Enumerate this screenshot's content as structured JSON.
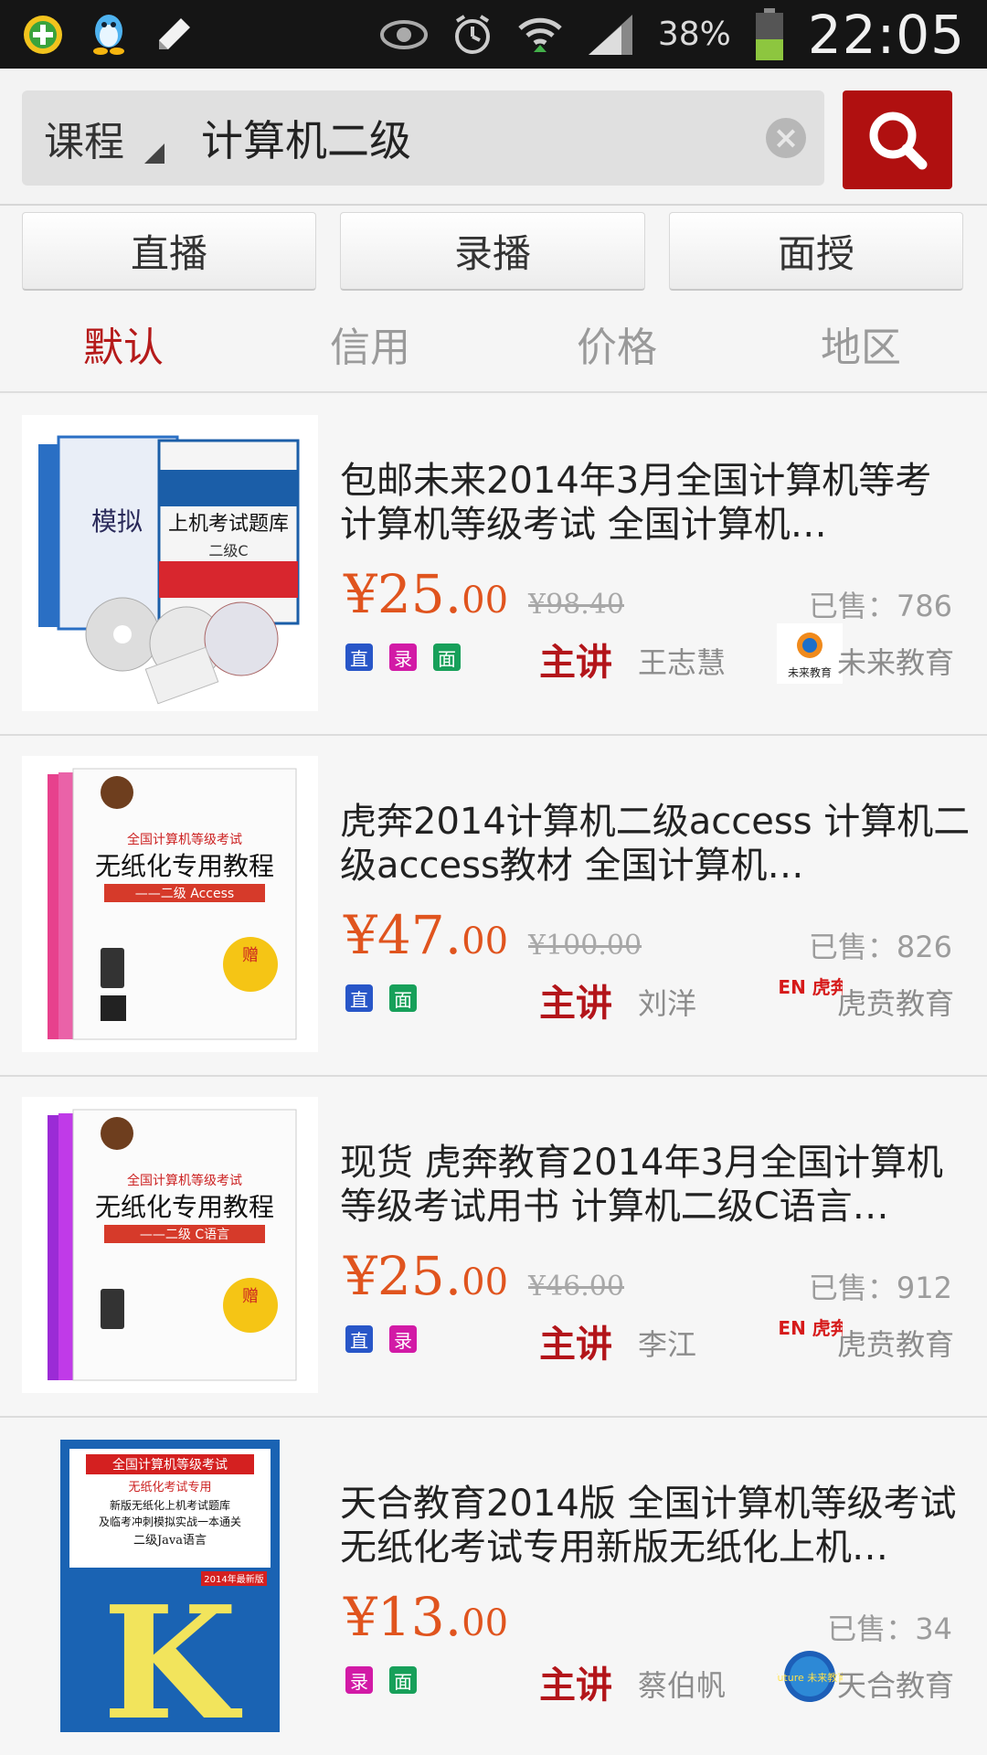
{
  "status_bar": {
    "icons_left": [
      "add-app-icon",
      "qq-penguin-icon",
      "pencil-icon"
    ],
    "icons_right": [
      "eye-icon",
      "alarm-icon",
      "wifi-icon",
      "signal-icon"
    ],
    "battery": "38%",
    "time": "22:05"
  },
  "search": {
    "scope": "课程",
    "query": "计算机二级",
    "clear_icon": "clear-icon",
    "search_icon": "search-icon"
  },
  "modes": [
    "直播",
    "录播",
    "面授"
  ],
  "sort_tabs": [
    "默认",
    "信用",
    "价格",
    "地区"
  ],
  "active_sort": "默认",
  "teacher_label": "主讲",
  "colors": {
    "brand_red": "#b01010",
    "price": "#e0541e",
    "badge_live": "#2856c8",
    "badge_recorded": "#d21aa6",
    "badge_onsite": "#17a05a"
  },
  "products": [
    {
      "title": "包邮未来2014年3月全国计算机等考 计算机等级考试 全国计算机…",
      "price_int": "¥25.",
      "price_dec": "00",
      "orig_price": "¥98.40",
      "sold": "已售：786",
      "badges": [
        "直",
        "录",
        "面"
      ],
      "teacher": "王志慧",
      "org_name": "未来教育",
      "org_logo_text": "未来教育",
      "cover": {
        "lines": [
          "模拟",
          "上机考试题库",
          "二级C"
        ]
      }
    },
    {
      "title": "虎奔2014计算机二级access 计算机二级access教材 全国计算机…",
      "price_int": "¥47.",
      "price_dec": "00",
      "orig_price": "¥100.00",
      "sold": "已售：826",
      "badges": [
        "直",
        "面"
      ],
      "teacher": "刘洋",
      "org_name": "虎贲教育",
      "org_logo_text": "HUBEN 虎奔教育",
      "cover": {
        "lines": [
          "全国计算机等级考试",
          "无纸化专用教程",
          "——二级 Access",
          "赠"
        ]
      }
    },
    {
      "title": "现货 虎奔教育2014年3月全国计算机等级考试用书 计算机二级C语言…",
      "price_int": "¥25.",
      "price_dec": "00",
      "orig_price": "¥46.00",
      "sold": "已售：912",
      "badges": [
        "直",
        "录"
      ],
      "teacher": "李江",
      "org_name": "虎贲教育",
      "org_logo_text": "HUBEN 虎奔教育",
      "cover": {
        "lines": [
          "全国计算机等级考试",
          "无纸化专用教程",
          "——二级 C语言",
          "赠"
        ]
      }
    },
    {
      "title": "天合教育2014版 全国计算机等级考试 无纸化考试专用新版无纸化上机…",
      "price_int": "¥13.",
      "price_dec": "00",
      "orig_price": "",
      "sold": "已售：34",
      "badges": [
        "录",
        "面"
      ],
      "teacher": "蔡伯帆",
      "org_name": "天合教育",
      "org_logo_text": "Future 未来教育",
      "cover": {
        "lines": [
          "全国计算机等级考试",
          "无纸化考试专用",
          "新版无纸化上机考试题库",
          "及临考冲刺模拟实战一本通关",
          "二级Java语言",
          "2014年最新版",
          "K"
        ]
      }
    }
  ]
}
